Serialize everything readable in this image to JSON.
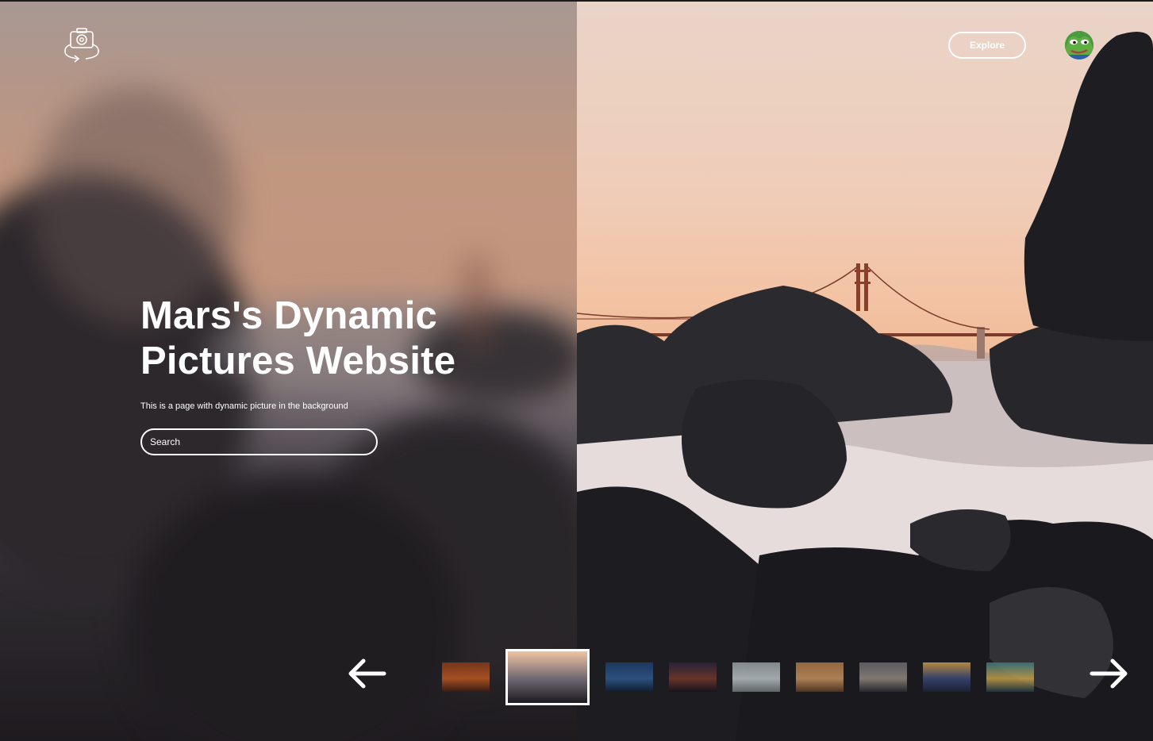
{
  "header": {
    "logo_icon": "camera-rotate-icon",
    "explore_label": "Explore",
    "avatar_icon": "frog-avatar-icon"
  },
  "hero": {
    "title_line1": "Mars's Dynamic",
    "title_line2": "Pictures Website",
    "subtitle": "This is a page with dynamic picture in the background",
    "search_placeholder": "Search"
  },
  "carousel": {
    "prev_icon": "arrow-left-icon",
    "next_icon": "arrow-right-icon",
    "active_index": 1,
    "thumbnails": [
      {
        "colors": [
          "#8a3a18",
          "#c45a22",
          "#3a1a10"
        ]
      },
      {
        "colors": [
          "#f0c2a2",
          "#6b6570",
          "#1c1b1f"
        ]
      },
      {
        "colors": [
          "#1d3e6e",
          "#2f5d94",
          "#0d1c33"
        ]
      },
      {
        "colors": [
          "#2a2340",
          "#7a3a2a",
          "#15121c"
        ]
      },
      {
        "colors": [
          "#9aa4a8",
          "#c4ccd0",
          "#6f787c"
        ]
      },
      {
        "colors": [
          "#b07a48",
          "#d19a62",
          "#5a3a22"
        ]
      },
      {
        "colors": [
          "#6b6a70",
          "#9a8f86",
          "#2a2a30"
        ]
      },
      {
        "colors": [
          "#d9a24a",
          "#3b4a7a",
          "#1c2238"
        ]
      },
      {
        "colors": [
          "#3a7a86",
          "#d1a94a",
          "#1d3a48"
        ]
      }
    ]
  }
}
